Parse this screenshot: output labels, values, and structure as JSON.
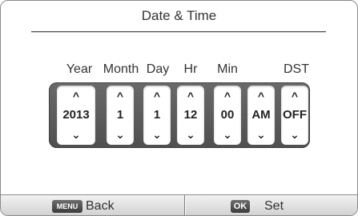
{
  "header": {
    "title": "Date & Time"
  },
  "fields": [
    {
      "key": "year",
      "label": "Year",
      "value": "2013"
    },
    {
      "key": "month",
      "label": "Month",
      "value": "1"
    },
    {
      "key": "day",
      "label": "Day",
      "value": "1"
    },
    {
      "key": "hour",
      "label": "Hr",
      "value": "12"
    },
    {
      "key": "min",
      "label": "Min",
      "value": "00"
    },
    {
      "key": "ampm",
      "label": "",
      "value": "AM"
    },
    {
      "key": "dst",
      "label": "DST",
      "value": "OFF"
    }
  ],
  "arrows": {
    "up": "^",
    "down": "⌄"
  },
  "footer": {
    "back": {
      "key": "MENU",
      "label": "Back"
    },
    "set": {
      "key": "OK",
      "label": "Set"
    }
  },
  "icons": {
    "up_arrow": "chevron-up-icon",
    "down_arrow": "chevron-down-icon"
  }
}
